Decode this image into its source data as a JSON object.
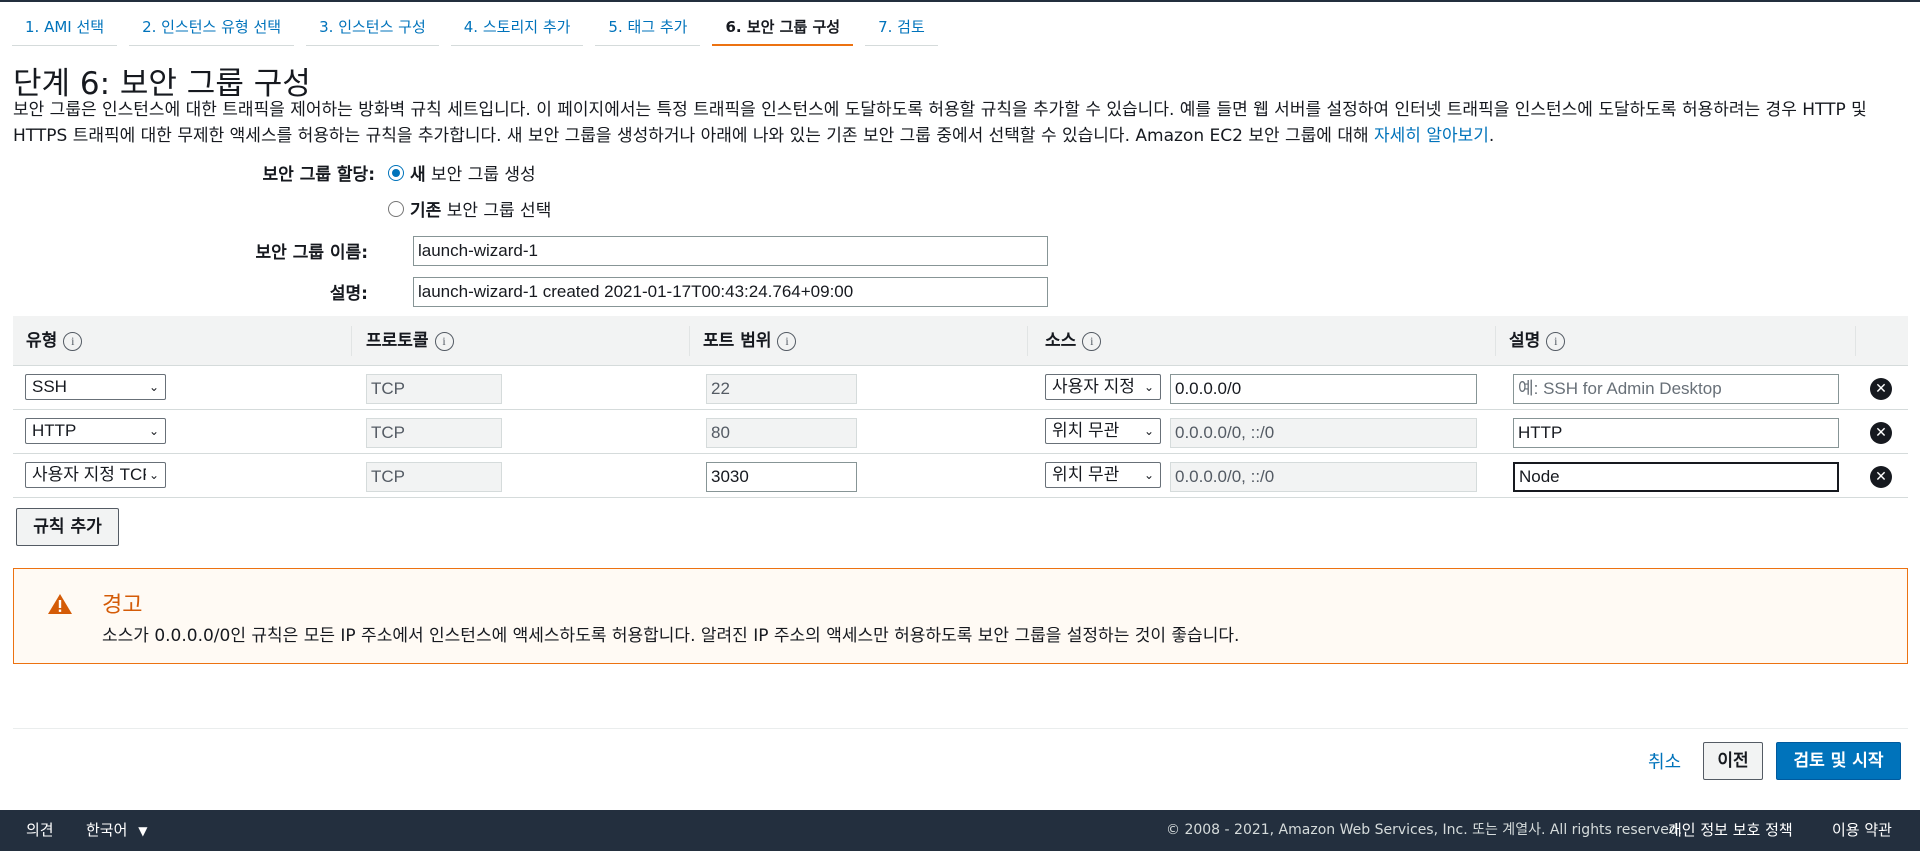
{
  "tabs": [
    {
      "label": "1. AMI 선택"
    },
    {
      "label": "2. 인스턴스 유형 선택"
    },
    {
      "label": "3. 인스턴스 구성"
    },
    {
      "label": "4. 스토리지 추가"
    },
    {
      "label": "5. 태그 추가"
    },
    {
      "label": "6. 보안 그룹 구성"
    },
    {
      "label": "7. 검토"
    }
  ],
  "page": {
    "title": "단계 6: 보안 그룹 구성",
    "intro": "보안 그룹은 인스턴스에 대한 트래픽을 제어하는 방화벽 규칙 세트입니다. 이 페이지에서는 특정 트래픽을 인스턴스에 도달하도록 허용할 규칙을 추가할 수 있습니다. 예를 들면 웹 서버를 설정하여 인터넷 트래픽을 인스턴스에 도달하도록 허용하려는 경우 HTTP 및 HTTPS 트래픽에 대한 무제한 액세스를 허용하는 규칙을 추가합니다. 새 보안 그룹을 생성하거나 아래에 나와 있는 기존 보안 그룹 중에서 선택할 수 있습니다. Amazon EC2 보안 그룹에 대해 ",
    "learn_more": "자세히 알아보기",
    "intro_end": "."
  },
  "form": {
    "assign_label": "보안 그룹 할당:",
    "option_new_bold": "새",
    "option_new_rest": "보안 그룹 생성",
    "option_existing_bold": "기존",
    "option_existing_rest": "보안 그룹 선택",
    "name_label": "보안 그룹 이름:",
    "name_value": "launch-wizard-1",
    "desc_label": "설명:",
    "desc_value": "launch-wizard-1 created 2021-01-17T00:43:24.764+09:00"
  },
  "table": {
    "headers": {
      "type": "유형",
      "protocol": "프로토콜",
      "port_range": "포트 범위",
      "source": "소스",
      "description": "설명"
    },
    "info_glyph": "i",
    "remove_glyph": "✕",
    "chevron_glyph": "⌄",
    "rows": [
      {
        "type": "SSH",
        "protocol": "TCP",
        "port": "22",
        "source_type": "사용자 지정",
        "source_cidr": "0.0.0.0/0",
        "description": "예: SSH for Admin Desktop"
      },
      {
        "type": "HTTP",
        "protocol": "TCP",
        "port": "80",
        "source_type": "위치 무관",
        "source_cidr": "0.0.0.0/0, ::/0",
        "description": "HTTP"
      },
      {
        "type": "사용자 지정 TCP",
        "protocol": "TCP",
        "port": "3030",
        "source_type": "위치 무관",
        "source_cidr": "0.0.0.0/0, ::/0",
        "description": "Node"
      }
    ]
  },
  "add_rule_label": "규칙 추가",
  "warning": {
    "title": "경고",
    "text": "소스가 0.0.0.0/0인 규칙은 모든 IP 주소에서 인스턴스에 액세스하도록 허용합니다. 알려진 IP 주소의 액세스만 허용하도록 보안 그룹을 설정하는 것이 좋습니다.",
    "color": "#ec7211"
  },
  "actions": {
    "cancel": "취소",
    "previous": "이전",
    "review_launch": "검토 및 시작"
  },
  "footer": {
    "feedback": "의견",
    "language": "한국어",
    "copyright": "© 2008 - 2021, Amazon Web Services, Inc. 또는 계열사. All rights reserved.",
    "privacy": "개인 정보 보호 정책",
    "terms": "이용 약관"
  }
}
